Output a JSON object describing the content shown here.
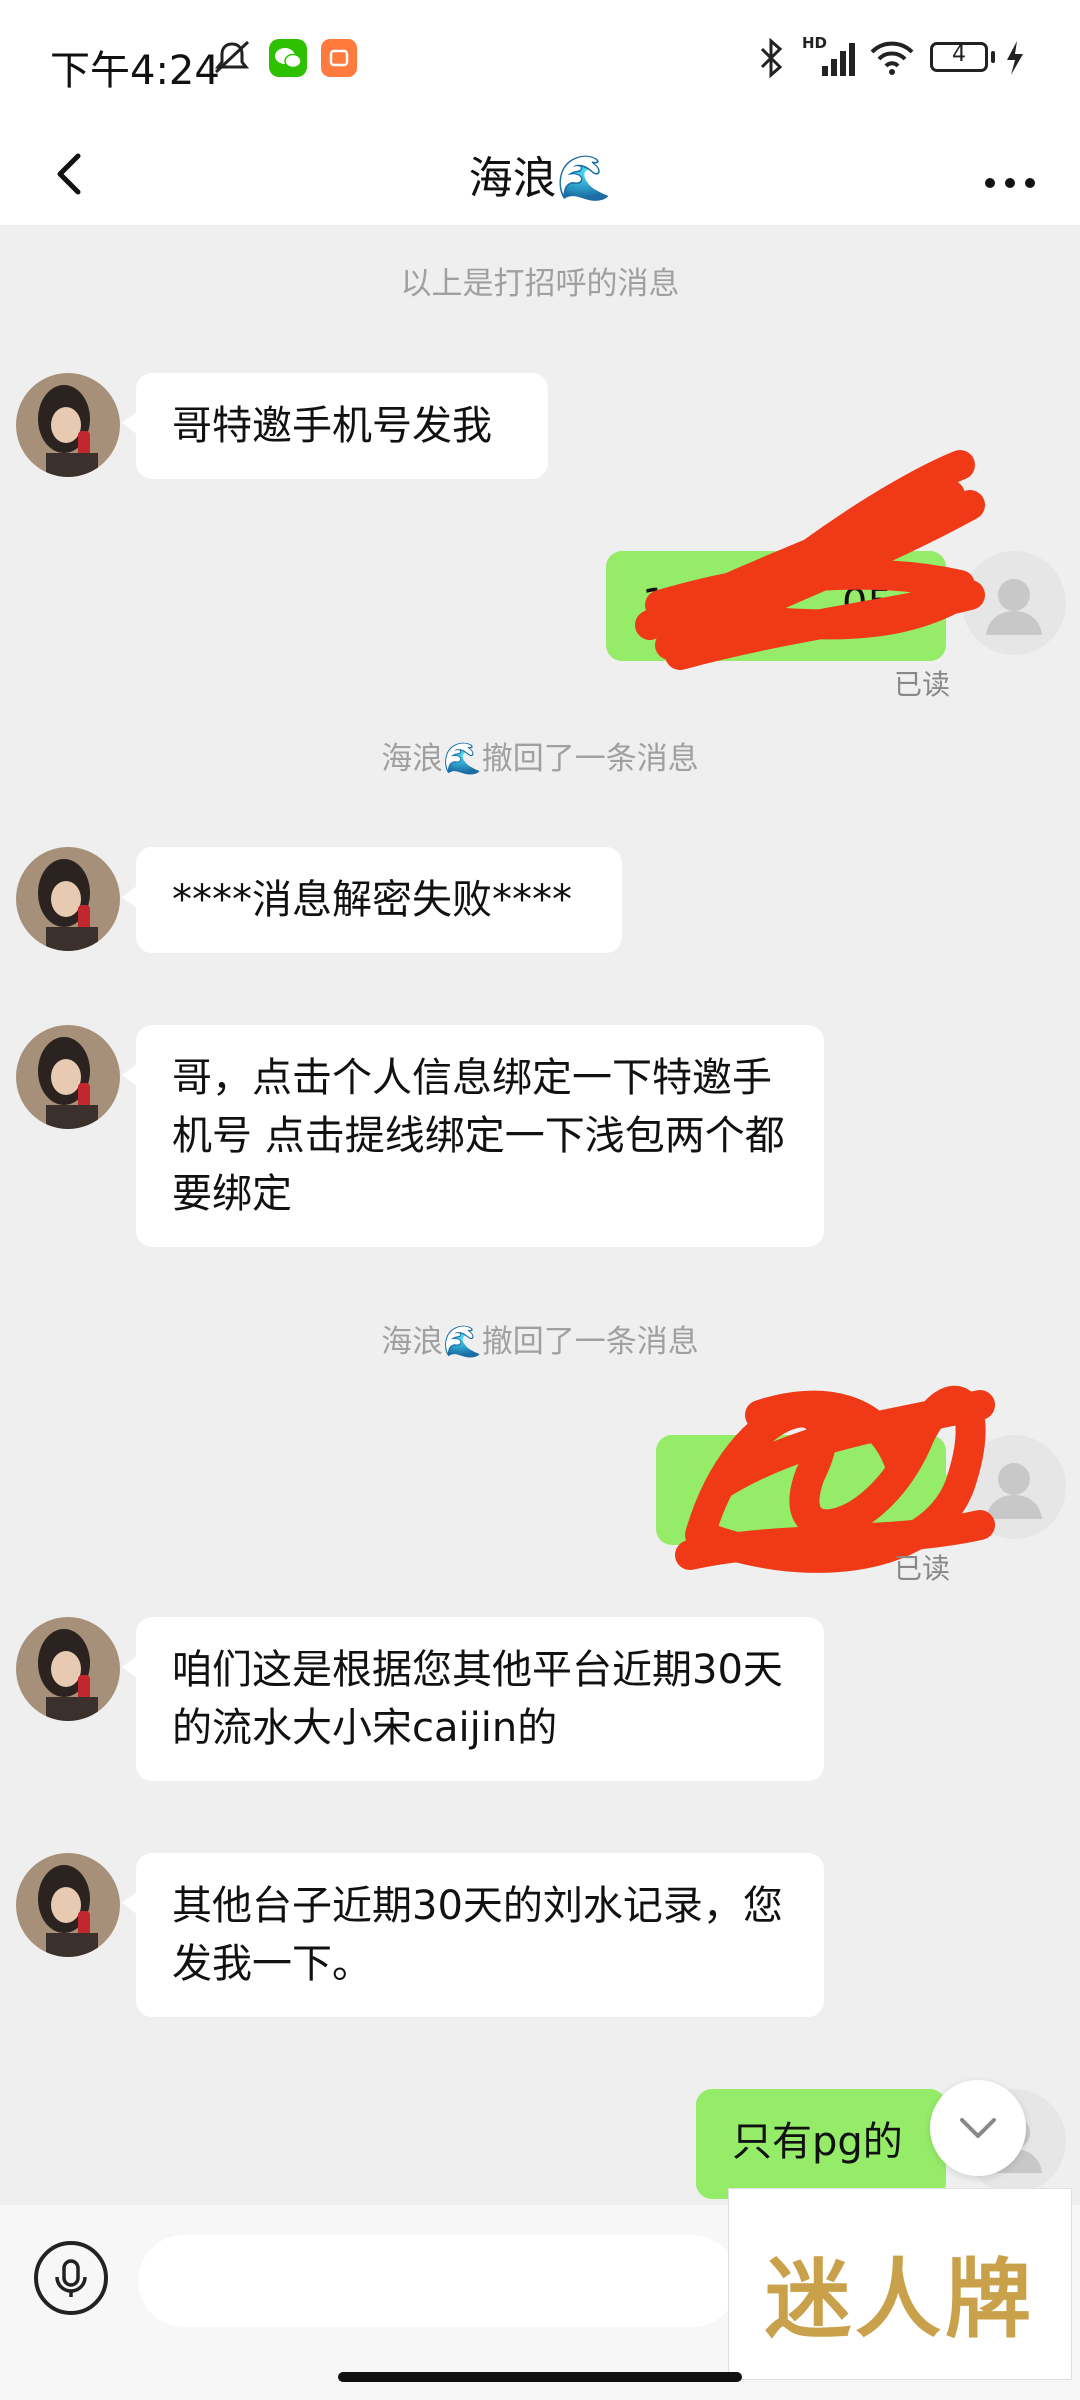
{
  "status_bar": {
    "time": "下午4:24",
    "network": "HD",
    "battery": "4"
  },
  "header": {
    "title": "海浪🌊"
  },
  "messages": {
    "greeting_note": "以上是打招呼的消息",
    "m1": "哥特邀手机号发我",
    "m2_visible_prefix": "19",
    "m2_visible_suffix": "05",
    "read_label_1": "已读",
    "recall_1": "海浪🌊撤回了一条消息",
    "m3": "****消息解密失败****",
    "m4": "哥，点击个人信息绑定一下特邀手机号 点击提线绑定一下浅包两个都要绑定",
    "recall_2": "海浪🌊撤回了一条消息",
    "read_label_2": "已读",
    "m5": "咱们这是根据您其他平台近期30天的流水大小宋caijin的",
    "m6": "其他台子近期30天的刘水记录，您发我一下。",
    "m7": "只有pg的"
  },
  "input": {
    "placeholder": ""
  },
  "watermark": {
    "text": "迷人牌"
  },
  "colors": {
    "sent_bubble": "#95ec69",
    "received_bubble": "#ffffff",
    "background": "#efefef",
    "redaction": "#f03a17"
  },
  "icons": [
    "back-arrow-icon",
    "more-icon",
    "mute-icon",
    "wechat-icon",
    "app-icon",
    "bluetooth-icon",
    "signal-icon",
    "wifi-icon",
    "battery-icon",
    "charging-icon",
    "default-avatar-icon",
    "chevron-down-icon",
    "microphone-icon"
  ]
}
